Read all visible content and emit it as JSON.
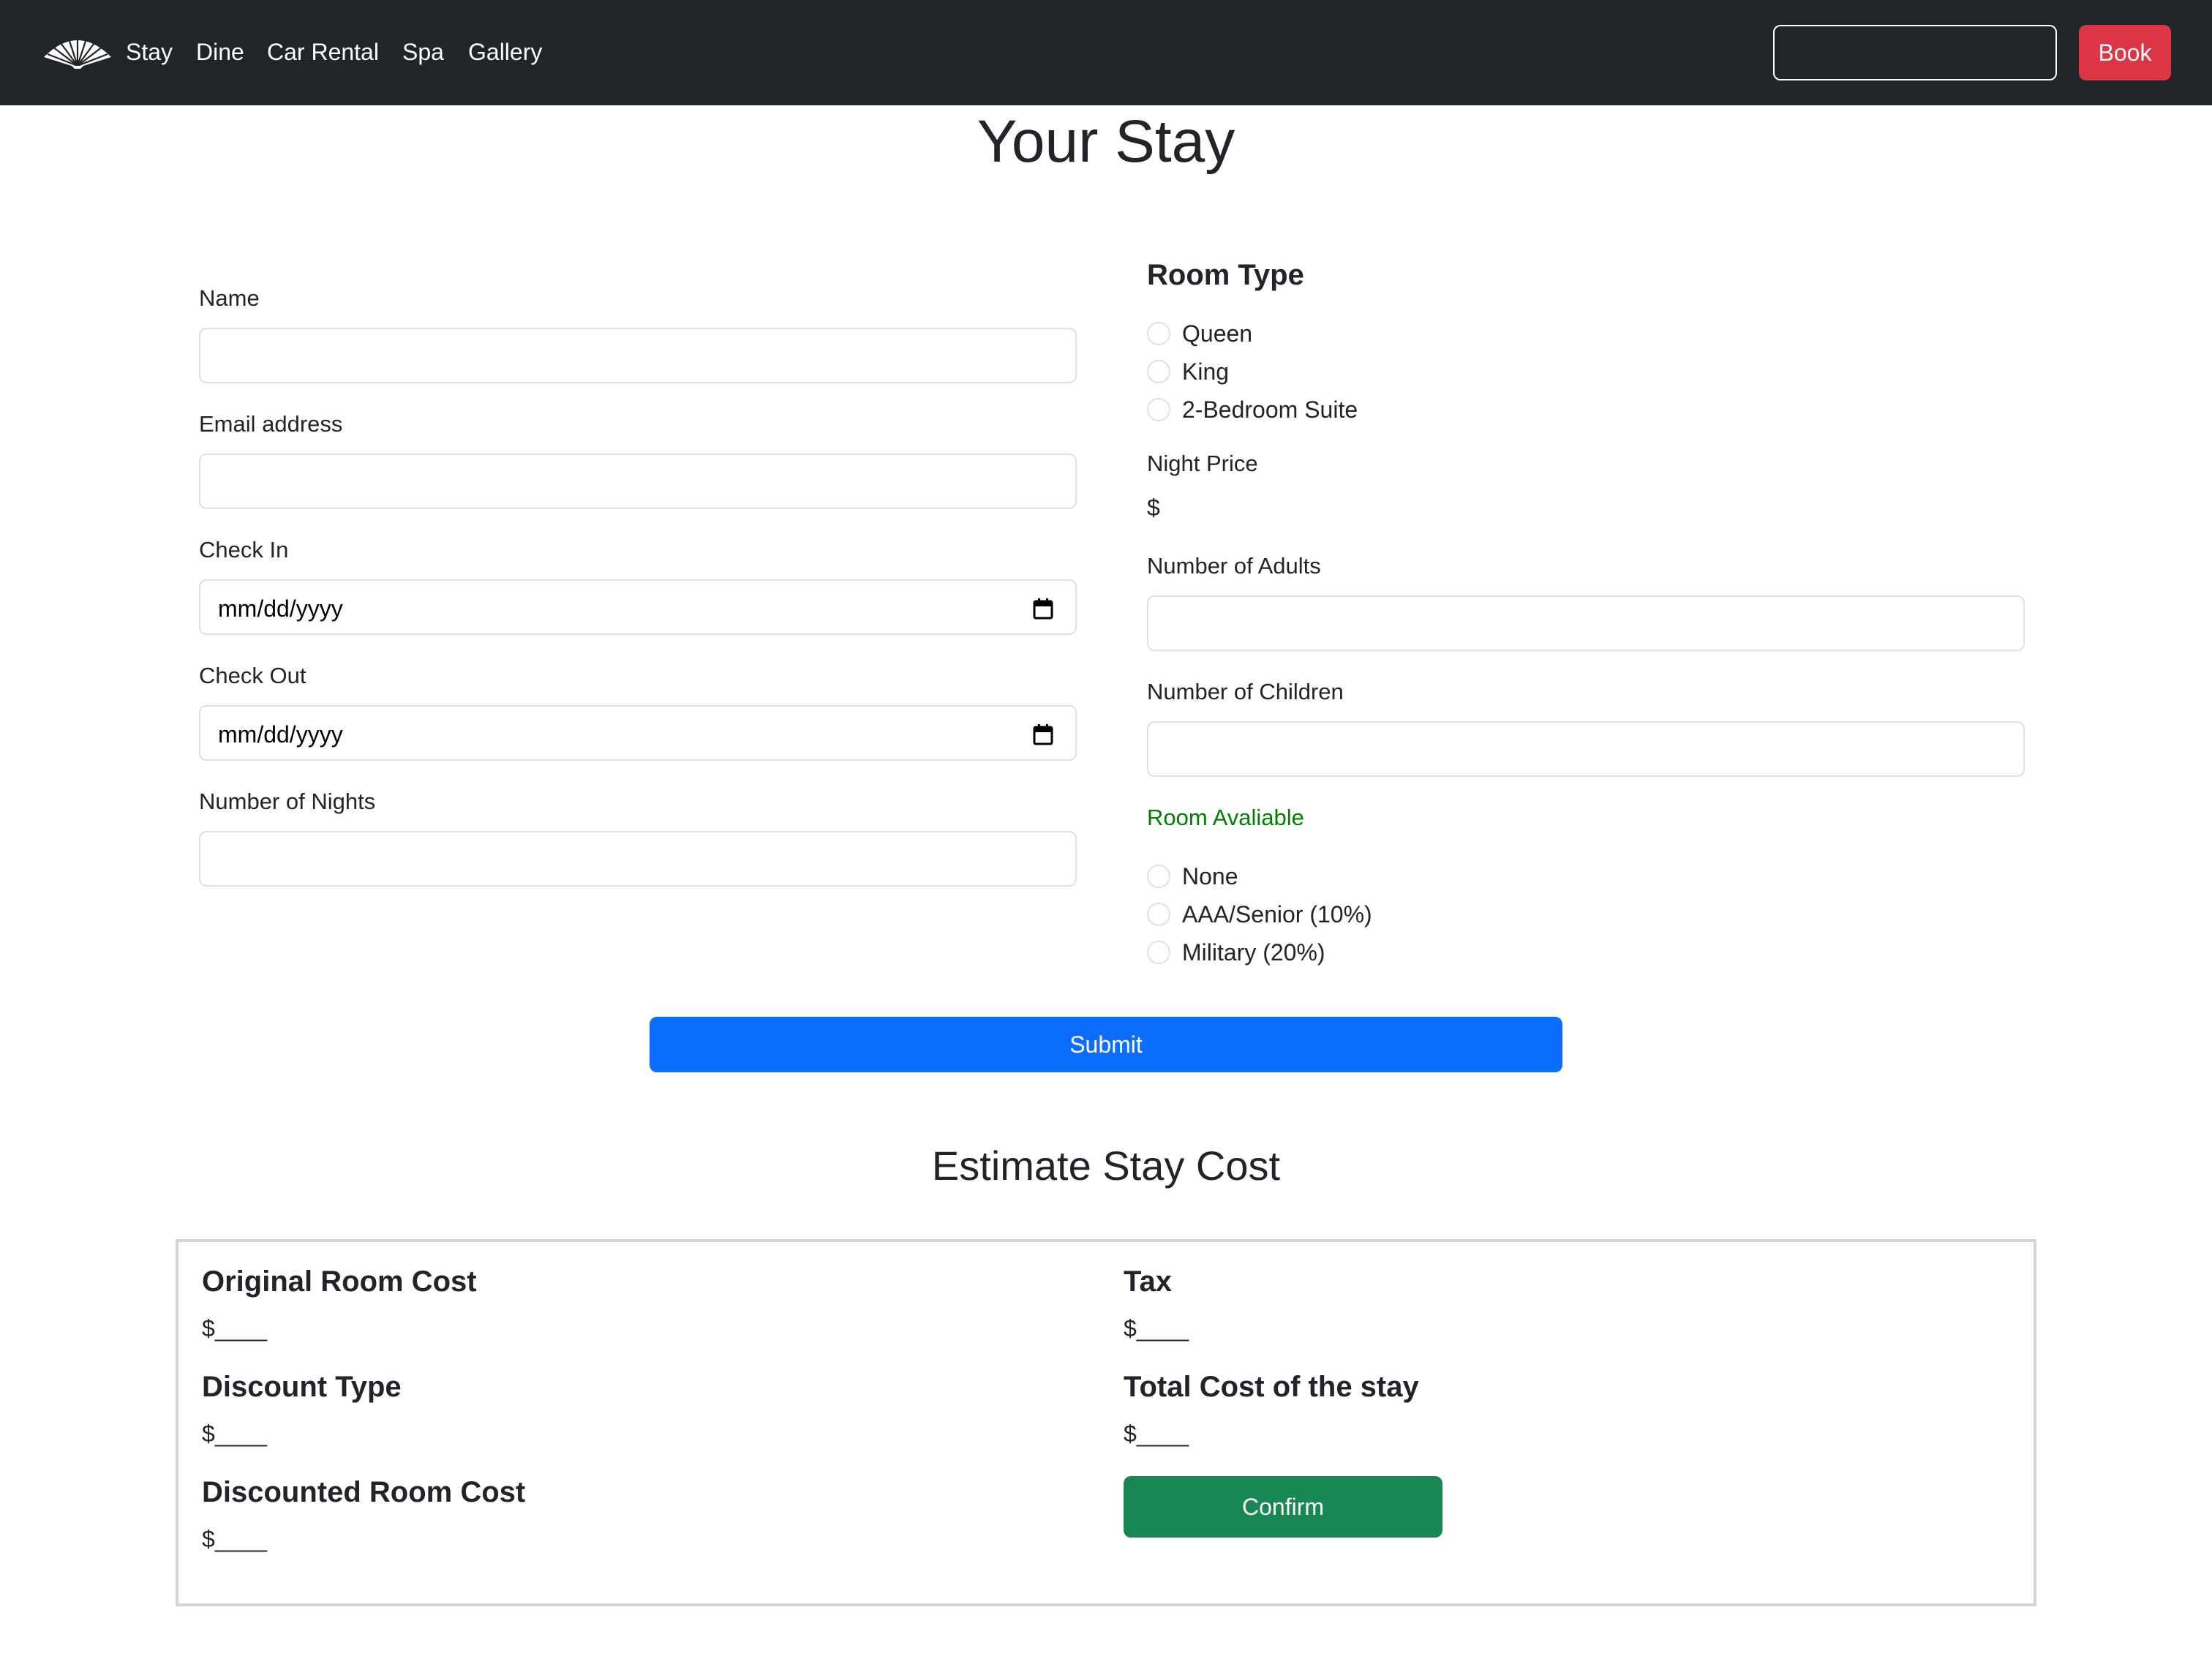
{
  "navbar": {
    "logo_icon": "fan-logo-icon",
    "links": [
      "Stay",
      "Dine",
      "Car Rental",
      "Spa",
      "Gallery"
    ],
    "search": {
      "value": "",
      "placeholder": ""
    },
    "book_label": "Book"
  },
  "page": {
    "title": "Your Stay"
  },
  "form": {
    "name": {
      "label": "Name",
      "value": ""
    },
    "email": {
      "label": "Email address",
      "value": ""
    },
    "check_in": {
      "label": "Check In",
      "placeholder": "mm/dd/yyyy"
    },
    "check_out": {
      "label": "Check Out",
      "placeholder": "mm/dd/yyyy"
    },
    "nights": {
      "label": "Number of Nights",
      "value": ""
    },
    "room_type": {
      "heading": "Room Type",
      "options": [
        "Queen",
        "King",
        "2-Bedroom Suite"
      ]
    },
    "night_price": {
      "label": "Night Price",
      "value": "$"
    },
    "adults": {
      "label": "Number of Adults",
      "value": ""
    },
    "children": {
      "label": "Number of Children",
      "value": ""
    },
    "availability": {
      "text": "Room Avaliable",
      "color": "#008000"
    },
    "discount_options": [
      "None",
      "AAA/Senior (10%)",
      "Military (20%)"
    ],
    "submit_label": "Submit"
  },
  "estimate": {
    "title": "Estimate Stay Cost",
    "original_room_cost": {
      "label": "Original Room Cost",
      "value": "$____"
    },
    "discount_type": {
      "label": "Discount Type",
      "value": "$____"
    },
    "discounted_room_cost": {
      "label": "Discounted Room Cost",
      "value": "$____"
    },
    "tax": {
      "label": "Tax",
      "value": "$____"
    },
    "total_cost": {
      "label": "Total Cost of the stay",
      "value": "$____"
    },
    "confirm_label": "Confirm"
  },
  "colors": {
    "navbar_bg": "#212529",
    "book_button": "#dc3545",
    "submit_button": "#0d6efd",
    "confirm_button": "#198754"
  }
}
